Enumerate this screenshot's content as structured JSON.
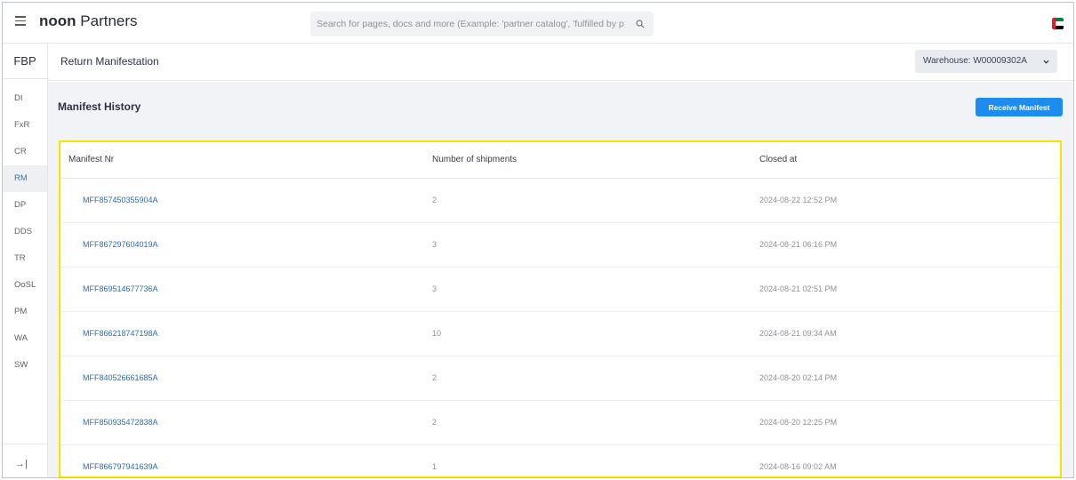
{
  "topbar": {
    "brand_bold": "noon",
    "brand_rest": " Partners",
    "search_placeholder": "Search for pages, docs and more (Example: 'partner catalog', 'fulfilled by p"
  },
  "sidebar": {
    "title": "FBP",
    "items": [
      {
        "label": "DI"
      },
      {
        "label": "FxR"
      },
      {
        "label": "CR"
      },
      {
        "label": "RM",
        "active": true
      },
      {
        "label": "DP"
      },
      {
        "label": "DDS"
      },
      {
        "label": "TR"
      },
      {
        "label": "OoSL"
      },
      {
        "label": "PM"
      },
      {
        "label": "WA"
      },
      {
        "label": "SW"
      }
    ],
    "collapse_glyph": "→|"
  },
  "header": {
    "title": "Return Manifestation",
    "warehouse_label": "Warehouse:  W00009302A"
  },
  "main": {
    "section_title": "Manifest History",
    "receive_button": "Receive Manifest",
    "columns": [
      "Manifest Nr",
      "Number of shipments",
      "Closed at"
    ],
    "rows": [
      {
        "manifest": "MFF857450355904A",
        "shipments": "2",
        "closed": "2024-08-22 12:52 PM"
      },
      {
        "manifest": "MFF867297604019A",
        "shipments": "3",
        "closed": "2024-08-21 06:16 PM"
      },
      {
        "manifest": "MFF869514677736A",
        "shipments": "3",
        "closed": "2024-08-21 02:51 PM"
      },
      {
        "manifest": "MFF866218747198A",
        "shipments": "10",
        "closed": "2024-08-21 09:34 AM"
      },
      {
        "manifest": "MFF840526661685A",
        "shipments": "2",
        "closed": "2024-08-20 02:14 PM"
      },
      {
        "manifest": "MFF850935472838A",
        "shipments": "2",
        "closed": "2024-08-20 12:25 PM"
      },
      {
        "manifest": "MFF866797941639A",
        "shipments": "1",
        "closed": "2024-08-16 09:02 AM"
      }
    ]
  },
  "colors": {
    "accent": "#1d8cf0",
    "link": "#2e6db4",
    "highlight_border": "#f5e600",
    "flag_red": "#e21b2d",
    "flag_green": "#00843d",
    "flag_white": "#ffffff",
    "flag_black": "#000000"
  }
}
